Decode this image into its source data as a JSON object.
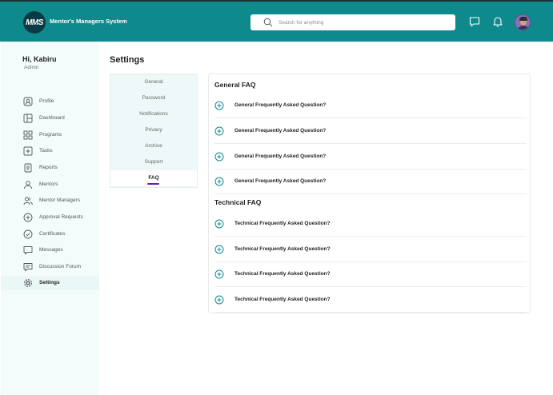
{
  "header": {
    "logo_text": "MMS",
    "brand": "Mentor's Managers System",
    "search_placeholder": "Search for anything",
    "icons": [
      "search-icon",
      "chat-icon",
      "bell-icon",
      "avatar"
    ]
  },
  "user": {
    "greeting": "Hi, Kabiru",
    "role": "Admin"
  },
  "sidebar": {
    "items": [
      {
        "label": "Profile",
        "icon": "profile-icon"
      },
      {
        "label": "Dashboard",
        "icon": "dashboard-icon"
      },
      {
        "label": "Programs",
        "icon": "programs-icon"
      },
      {
        "label": "Tasks",
        "icon": "tasks-icon"
      },
      {
        "label": "Reports",
        "icon": "reports-icon"
      },
      {
        "label": "Mentors",
        "icon": "mentors-icon"
      },
      {
        "label": "Mentor Managers",
        "icon": "mentor-managers-icon"
      },
      {
        "label": "Approval Requests",
        "icon": "approval-icon"
      },
      {
        "label": "Certificates",
        "icon": "certificates-icon"
      },
      {
        "label": "Messages",
        "icon": "messages-icon"
      },
      {
        "label": "Discussion Forum",
        "icon": "forum-icon"
      },
      {
        "label": "Settings",
        "icon": "settings-icon",
        "active": true
      }
    ]
  },
  "settings": {
    "title": "Settings",
    "tabs": [
      "General",
      "Password",
      "Notifications",
      "Privacy",
      "Archive",
      "Support",
      "FAQ"
    ],
    "active_tab": "FAQ"
  },
  "faq": {
    "general_title": "General FAQ",
    "general": [
      "General Frequently Asked Question?",
      "General Frequently Asked Question?",
      "General Frequently Asked Question?",
      "General Frequently Asked Question?"
    ],
    "technical_title": "Technical FAQ",
    "technical": [
      "Technical Frequently Asked Question?",
      "Technical Frequently Asked Question?",
      "Technical Frequently Asked Question?",
      "Technical Frequently Asked Question?"
    ]
  },
  "colors": {
    "primary": "#0f8a8c",
    "accent": "#5b21b6",
    "sidebar_bg": "#f4fbfb"
  }
}
